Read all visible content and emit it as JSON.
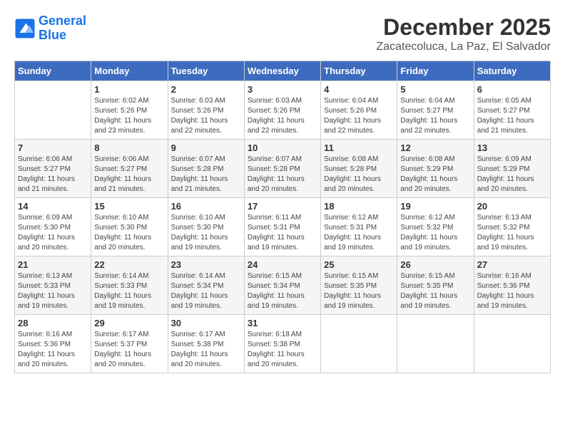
{
  "header": {
    "logo_line1": "General",
    "logo_line2": "Blue",
    "month_year": "December 2025",
    "location": "Zacatecoluca, La Paz, El Salvador"
  },
  "weekdays": [
    "Sunday",
    "Monday",
    "Tuesday",
    "Wednesday",
    "Thursday",
    "Friday",
    "Saturday"
  ],
  "weeks": [
    [
      {
        "day": "",
        "sunrise": "",
        "sunset": "",
        "daylight": ""
      },
      {
        "day": "1",
        "sunrise": "6:02 AM",
        "sunset": "5:26 PM",
        "daylight": "11 hours and 23 minutes."
      },
      {
        "day": "2",
        "sunrise": "6:03 AM",
        "sunset": "5:26 PM",
        "daylight": "11 hours and 22 minutes."
      },
      {
        "day": "3",
        "sunrise": "6:03 AM",
        "sunset": "5:26 PM",
        "daylight": "11 hours and 22 minutes."
      },
      {
        "day": "4",
        "sunrise": "6:04 AM",
        "sunset": "5:26 PM",
        "daylight": "11 hours and 22 minutes."
      },
      {
        "day": "5",
        "sunrise": "6:04 AM",
        "sunset": "5:27 PM",
        "daylight": "11 hours and 22 minutes."
      },
      {
        "day": "6",
        "sunrise": "6:05 AM",
        "sunset": "5:27 PM",
        "daylight": "11 hours and 21 minutes."
      }
    ],
    [
      {
        "day": "7",
        "sunrise": "6:06 AM",
        "sunset": "5:27 PM",
        "daylight": "11 hours and 21 minutes."
      },
      {
        "day": "8",
        "sunrise": "6:06 AM",
        "sunset": "5:27 PM",
        "daylight": "11 hours and 21 minutes."
      },
      {
        "day": "9",
        "sunrise": "6:07 AM",
        "sunset": "5:28 PM",
        "daylight": "11 hours and 21 minutes."
      },
      {
        "day": "10",
        "sunrise": "6:07 AM",
        "sunset": "5:28 PM",
        "daylight": "11 hours and 20 minutes."
      },
      {
        "day": "11",
        "sunrise": "6:08 AM",
        "sunset": "5:28 PM",
        "daylight": "11 hours and 20 minutes."
      },
      {
        "day": "12",
        "sunrise": "6:08 AM",
        "sunset": "5:29 PM",
        "daylight": "11 hours and 20 minutes."
      },
      {
        "day": "13",
        "sunrise": "6:09 AM",
        "sunset": "5:29 PM",
        "daylight": "11 hours and 20 minutes."
      }
    ],
    [
      {
        "day": "14",
        "sunrise": "6:09 AM",
        "sunset": "5:30 PM",
        "daylight": "11 hours and 20 minutes."
      },
      {
        "day": "15",
        "sunrise": "6:10 AM",
        "sunset": "5:30 PM",
        "daylight": "11 hours and 20 minutes."
      },
      {
        "day": "16",
        "sunrise": "6:10 AM",
        "sunset": "5:30 PM",
        "daylight": "11 hours and 19 minutes."
      },
      {
        "day": "17",
        "sunrise": "6:11 AM",
        "sunset": "5:31 PM",
        "daylight": "11 hours and 19 minutes."
      },
      {
        "day": "18",
        "sunrise": "6:12 AM",
        "sunset": "5:31 PM",
        "daylight": "11 hours and 19 minutes."
      },
      {
        "day": "19",
        "sunrise": "6:12 AM",
        "sunset": "5:32 PM",
        "daylight": "11 hours and 19 minutes."
      },
      {
        "day": "20",
        "sunrise": "6:13 AM",
        "sunset": "5:32 PM",
        "daylight": "11 hours and 19 minutes."
      }
    ],
    [
      {
        "day": "21",
        "sunrise": "6:13 AM",
        "sunset": "5:33 PM",
        "daylight": "11 hours and 19 minutes."
      },
      {
        "day": "22",
        "sunrise": "6:14 AM",
        "sunset": "5:33 PM",
        "daylight": "11 hours and 19 minutes."
      },
      {
        "day": "23",
        "sunrise": "6:14 AM",
        "sunset": "5:34 PM",
        "daylight": "11 hours and 19 minutes."
      },
      {
        "day": "24",
        "sunrise": "6:15 AM",
        "sunset": "5:34 PM",
        "daylight": "11 hours and 19 minutes."
      },
      {
        "day": "25",
        "sunrise": "6:15 AM",
        "sunset": "5:35 PM",
        "daylight": "11 hours and 19 minutes."
      },
      {
        "day": "26",
        "sunrise": "6:15 AM",
        "sunset": "5:35 PM",
        "daylight": "11 hours and 19 minutes."
      },
      {
        "day": "27",
        "sunrise": "6:16 AM",
        "sunset": "5:36 PM",
        "daylight": "11 hours and 19 minutes."
      }
    ],
    [
      {
        "day": "28",
        "sunrise": "6:16 AM",
        "sunset": "5:36 PM",
        "daylight": "11 hours and 20 minutes."
      },
      {
        "day": "29",
        "sunrise": "6:17 AM",
        "sunset": "5:37 PM",
        "daylight": "11 hours and 20 minutes."
      },
      {
        "day": "30",
        "sunrise": "6:17 AM",
        "sunset": "5:38 PM",
        "daylight": "11 hours and 20 minutes."
      },
      {
        "day": "31",
        "sunrise": "6:18 AM",
        "sunset": "5:38 PM",
        "daylight": "11 hours and 20 minutes."
      },
      {
        "day": "",
        "sunrise": "",
        "sunset": "",
        "daylight": ""
      },
      {
        "day": "",
        "sunrise": "",
        "sunset": "",
        "daylight": ""
      },
      {
        "day": "",
        "sunrise": "",
        "sunset": "",
        "daylight": ""
      }
    ]
  ]
}
